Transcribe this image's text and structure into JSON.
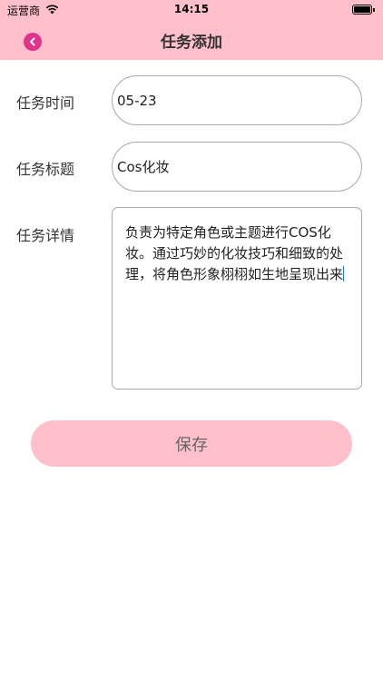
{
  "status_bar": {
    "carrier": "运营商",
    "time": "14:15"
  },
  "nav": {
    "title": "任务添加",
    "back_icon": "chevron-left-icon"
  },
  "form": {
    "time_label": "任务时间",
    "time_value": "05-23",
    "title_label": "任务标题",
    "title_value": "Cos化妆",
    "detail_label": "任务详情",
    "detail_value": "负责为特定角色或主题进行COS化妆。通过巧妙的化妆技巧和细致的处理，将角色形象栩栩如生地呈现出来"
  },
  "save_label": "保存",
  "colors": {
    "header": "#ffc0cb",
    "back_button": "#e0338a",
    "save_button": "#ffc0cb",
    "caret": "#1a73e8"
  }
}
